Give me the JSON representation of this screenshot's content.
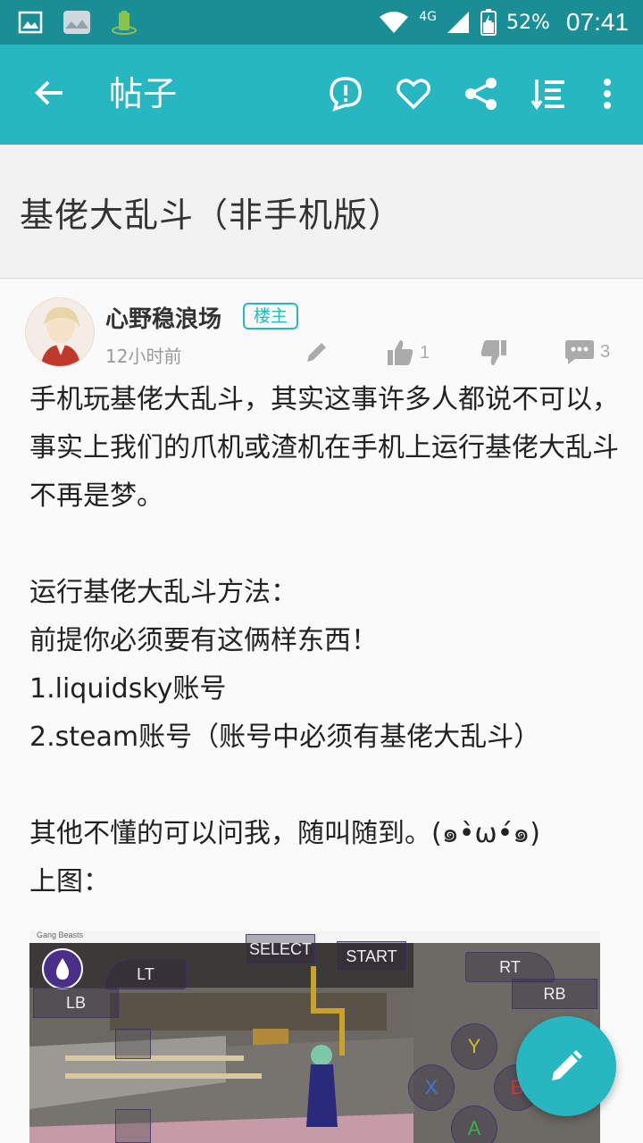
{
  "status_bar": {
    "network": "4G",
    "battery": "52%",
    "time": "07:41"
  },
  "toolbar": {
    "title": "帖子",
    "icons": [
      "back-arrow-icon",
      "report-icon",
      "heart-icon",
      "share-icon",
      "sort-icon",
      "more-icon"
    ]
  },
  "post": {
    "title": "基佬大乱斗（非手机版）",
    "author": "心野稳浪场",
    "badge": "楼主",
    "time_ago": "12小时前",
    "likes": "1",
    "comments": "3",
    "body": "手机玩基佬大乱斗，其实这事许多人都说不可以，事实上我们的爪机或渣机在手机上运行基佬大乱斗不再是梦。\n\n运行基佬大乱斗方法：\n前提你必须要有这俩样东西！\n1.liquidsky账号\n2.steam账号（账号中必须有基佬大乱斗）\n\n其他不懂的可以问我，随叫随到。(๑•̀ω•́๑)\n上图："
  },
  "image": {
    "window_title": "Gang Beasts",
    "controls": {
      "select": "SELECT",
      "start": "START",
      "lt": "LT",
      "lb": "LB",
      "rt": "RT",
      "rb": "RB",
      "y": "Y",
      "x": "X",
      "b": "B",
      "a": "A"
    }
  },
  "colors": {
    "primary": "#26b7c1",
    "status_bar": "#1a8e95"
  }
}
